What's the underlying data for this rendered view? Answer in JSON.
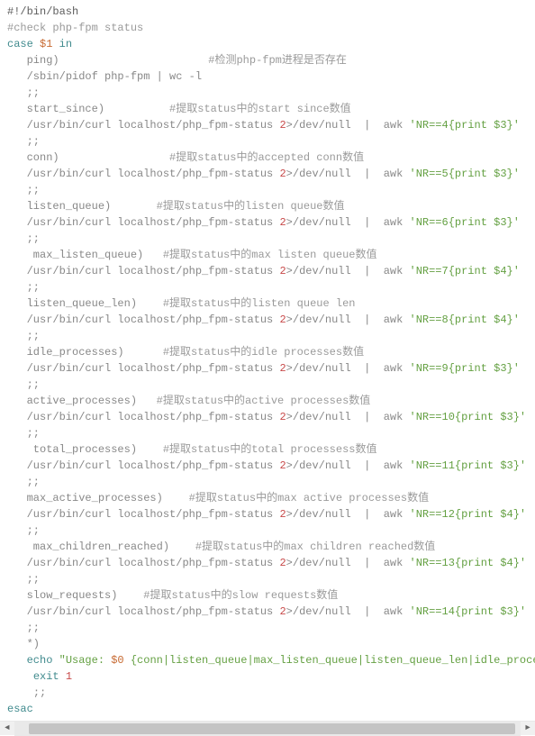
{
  "code": {
    "shebang": "#!/bin/bash",
    "comment_check": "#check php-fpm status",
    "case_kw": "case",
    "case_var": "$1",
    "in_kw": "in",
    "ping_case": "ping)",
    "ping_comment": "#检测php-fpm进程是否存在",
    "pidof_line": "/sbin/pidof php-fpm | wc -l",
    "dbl_semi": ";;",
    "start_since_case": "start_since)",
    "start_since_comment": "#提取status中的start since数值",
    "curl_prefix": "/usr/bin/curl localhost/php_fpm-status ",
    "curl_devnull": ">/dev/null  |  awk ",
    "two_num": "2",
    "awk_nr4": "'NR==4{print $3}'",
    "conn_case": "conn)",
    "conn_comment": "#提取status中的accepted conn数值",
    "awk_nr5": "'NR==5{print $3}'",
    "listen_queue_case": "listen_queue)",
    "listen_queue_comment": "#提取status中的listen queue数值",
    "awk_nr6": "'NR==6{print $3}'",
    "max_listen_queue_case": " max_listen_queue)",
    "max_listen_queue_comment": "#提取status中的max listen queue数值",
    "awk_nr7": "'NR==7{print $4}'",
    "listen_queue_len_case": "listen_queue_len)",
    "listen_queue_len_comment": "#提取status中的listen queue len",
    "awk_nr8": "'NR==8{print $4}'",
    "idle_processes_case": "idle_processes)",
    "idle_processes_comment": "#提取status中的idle processes数值",
    "awk_nr9": "'NR==9{print $3}'",
    "active_processes_case": "active_processes)",
    "active_processes_comment": "#提取status中的active processes数值",
    "awk_nr10": "'NR==10{print $3}'",
    "total_processes_case": " total_processes)",
    "total_processes_comment": "#提取status中的total processess数值",
    "awk_nr11": "'NR==11{print $3}'",
    "max_active_processes_case": "max_active_processes)",
    "max_active_processes_comment": "#提取status中的max active processes数值",
    "awk_nr12": "'NR==12{print $4}'",
    "max_children_reached_case": " max_children_reached)",
    "max_children_reached_comment": "#提取status中的max children reached数值",
    "awk_nr13": "'NR==13{print $4}'",
    "slow_requests_case": "slow_requests)",
    "slow_requests_comment": "#提取status中的slow requests数值",
    "awk_nr14": "'NR==14{print $3}'",
    "default_case": "*)",
    "echo_kw": "echo",
    "usage_pre": " \"Usage: ",
    "usage_var": "$0",
    "usage_post": " {conn|listen_queue|max_listen_queue|listen_queue_len|idle_processes|active_processess|total_processes|max_active_processes|max_children_reached|slow_requests}\"",
    "exit_kw": "exit",
    "exit_code": " 1",
    "esac_kw": "esac",
    "indent1": "   ",
    "indent2": "    "
  }
}
